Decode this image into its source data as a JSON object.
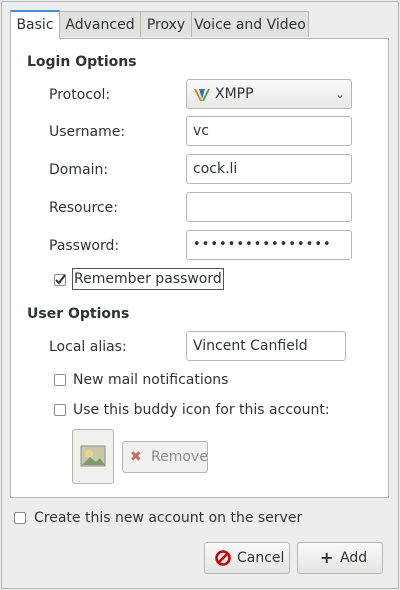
{
  "tabs": [
    "Basic",
    "Advanced",
    "Proxy",
    "Voice and Video"
  ],
  "login": {
    "title": "Login Options",
    "protocol_label": "Protocol:",
    "protocol_value": "XMPP",
    "username_label": "Username:",
    "username_value": "vc",
    "domain_label": "Domain:",
    "domain_value": "cock.li",
    "resource_label": "Resource:",
    "resource_value": "",
    "password_label": "Password:",
    "password_value": "••••••••••••••••",
    "remember_label": "Remember password",
    "remember_checked": true
  },
  "user": {
    "title": "User Options",
    "alias_label": "Local alias:",
    "alias_value": "Vincent Canfield",
    "newmail_label": "New mail notifications",
    "buddyicon_label": "Use this buddy icon for this account:",
    "remove_label": "Remove"
  },
  "footer": {
    "create_label": "Create this new account on the server",
    "cancel_label": "Cancel",
    "add_label": "Add"
  },
  "colors": {
    "accent": "#4a90d9",
    "cancel_red": "#cc0000"
  }
}
